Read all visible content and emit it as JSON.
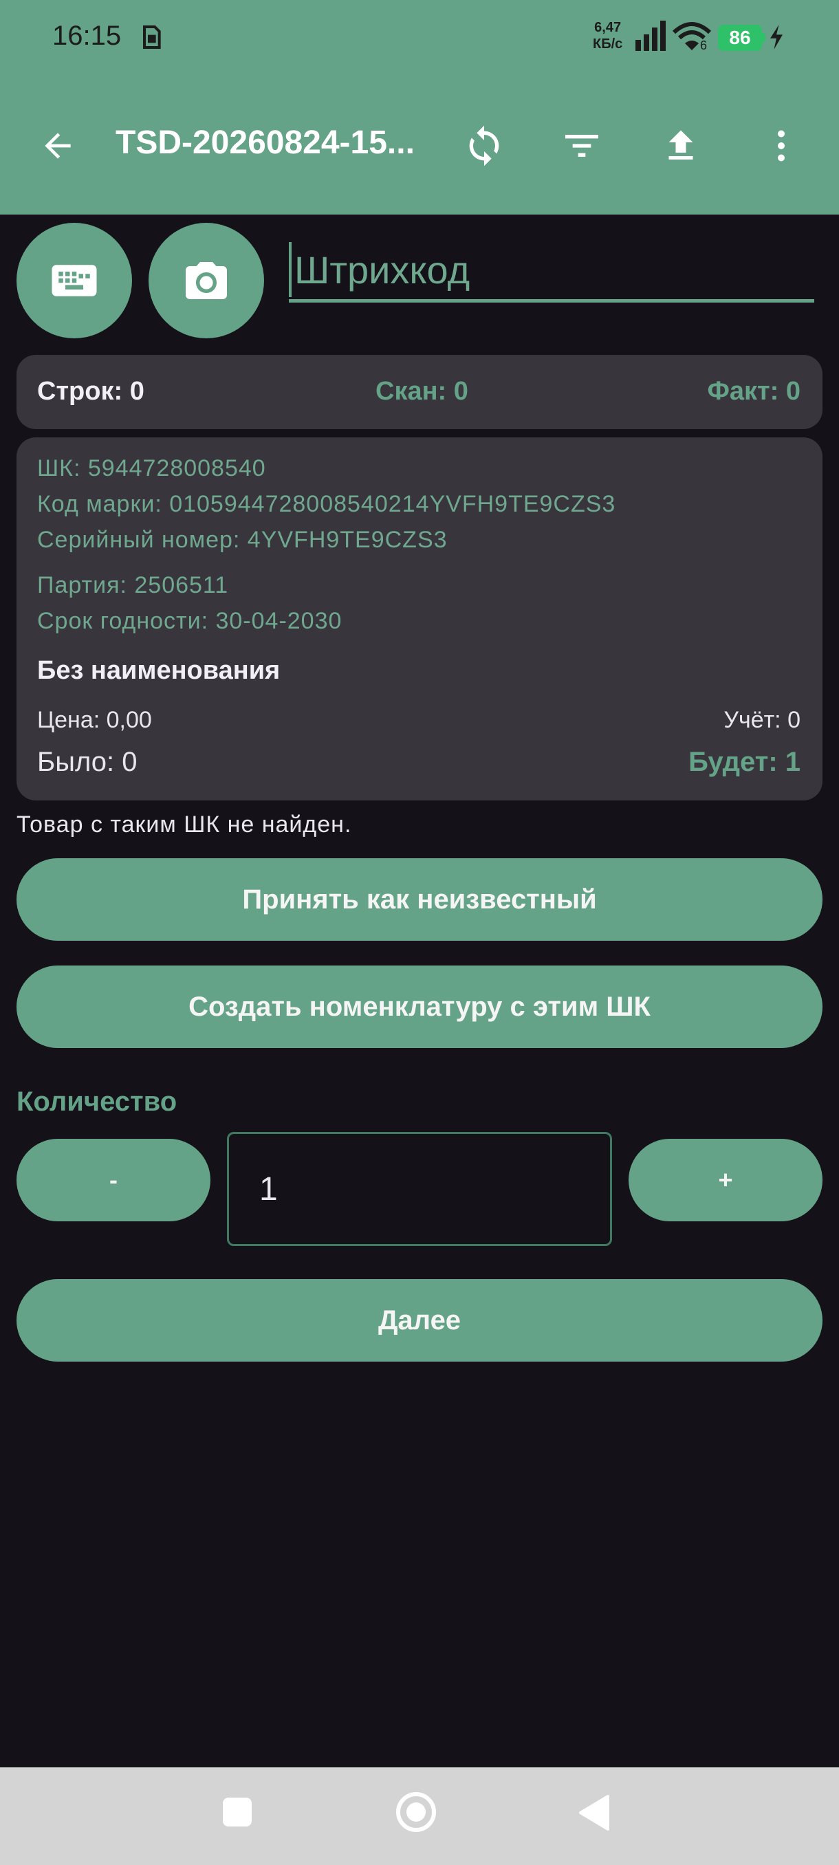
{
  "status_bar": {
    "time": "16:15",
    "net_speed_value": "6,47",
    "net_speed_unit": "КБ/с",
    "wifi_band": "6",
    "battery": "86"
  },
  "toolbar": {
    "title": "TSD-20260824-15..."
  },
  "scan": {
    "barcode_placeholder": "Штрихкод",
    "barcode_value": ""
  },
  "counters": {
    "lines": "Строк: 0",
    "scan": "Скан: 0",
    "fact": "Факт: 0"
  },
  "item": {
    "barcode": "ШК: 5944728008540",
    "mark_code": "Код марки: 010594472800854021​4YVFH9TE9CZS3",
    "serial": "Серийный номер: 4YVFH9TE9CZS3",
    "batch": "Партия: 2506511",
    "expiry": "Срок годности: 30-04-2030",
    "name": "Без наименования",
    "price": "Цена: 0,00",
    "account": "Учёт: 0",
    "was": "Было: 0",
    "will_be": "Будет: 1"
  },
  "message": "Товар с таким ШК не найден.",
  "actions": {
    "accept_unknown": "Принять как неизвестный",
    "create_nomenclature": "Создать номенклатуру с этим ШК"
  },
  "quantity": {
    "label": "Количество",
    "minus": "-",
    "value": "1",
    "plus": "+"
  },
  "next": "Далее",
  "colors": {
    "accent": "#64a387",
    "background": "#141218",
    "card": "#38353d"
  }
}
